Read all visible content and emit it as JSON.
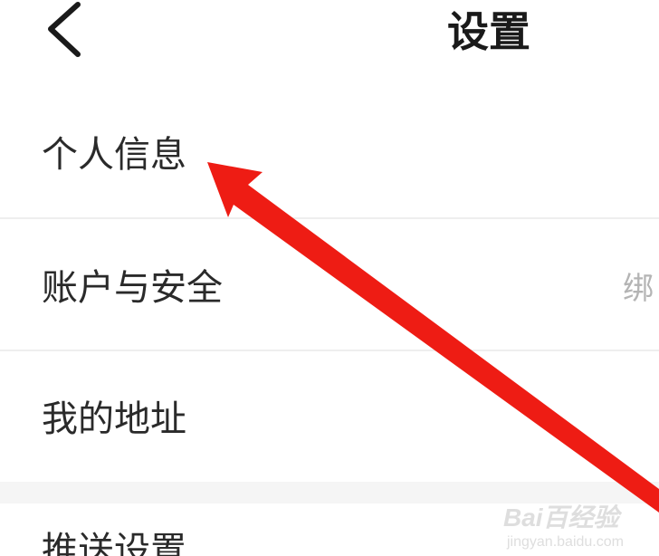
{
  "header": {
    "title": "设置",
    "back_icon": "chevron-left-icon"
  },
  "settings": {
    "items": [
      {
        "label": "个人信息",
        "value": ""
      },
      {
        "label": "账户与安全",
        "value": "绑"
      },
      {
        "label": "我的地址",
        "value": ""
      },
      {
        "label": "推送设置",
        "value": ""
      }
    ]
  },
  "annotation": {
    "arrow_color": "#ee1c14"
  },
  "watermark": {
    "brand": "Bai百经验",
    "url": "jingyan.baidu.com"
  },
  "colors": {
    "background": "#ffffff",
    "divider": "#eeeeee",
    "section_gap": "#f5f5f5",
    "label_text": "#2a2a2a",
    "value_text": "#b4b4b4"
  }
}
